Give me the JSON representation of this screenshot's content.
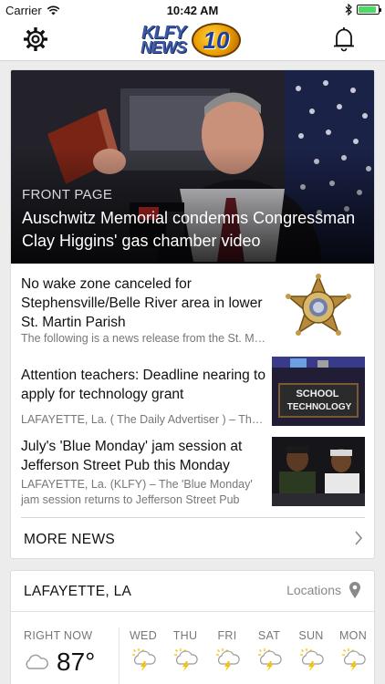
{
  "status_bar": {
    "carrier": "Carrier",
    "time": "10:42 AM",
    "battery_level": 0.9
  },
  "header": {
    "logo_text_top": "KLFY",
    "logo_text_bottom": "NEWS",
    "logo_number": "10"
  },
  "hero": {
    "kicker": "FRONT PAGE",
    "headline": "Auschwitz Memorial condemns Congressman Clay Higgins' gas chamber video"
  },
  "stories": [
    {
      "title": "No wake zone canceled for Stephensville/Belle River area in lower St. Martin Parish",
      "summary": "The following is a news release from the St. Martin Parish Sheriff's Office",
      "thumb_icon": "sheriff-star-badge"
    },
    {
      "title": "Attention teachers: Deadline nearing to apply for technology grant",
      "summary": "LAFAYETTE, La. ( The Daily Advertiser ) – The deadline to apply is near",
      "thumb_icon": "school-technology-chalkboard",
      "thumb_line1": "SCHOOL",
      "thumb_line2": "TECHNOLOGY"
    },
    {
      "title": "July's 'Blue Monday' jam session at Jefferson Street Pub this Monday",
      "summary": "LAFAYETTE, La. (KLFY) – The 'Blue Monday' jam session returns to Jefferson Street Pub next…",
      "thumb_icon": "musicians-photo"
    }
  ],
  "more_news": {
    "label": "MORE NEWS"
  },
  "weather": {
    "city": "LAFAYETTE, LA",
    "locations_label": "Locations",
    "right_now_label": "RIGHT NOW",
    "current_temp": "87°",
    "current_icon": "cloud-icon",
    "forecast": [
      {
        "day": "WED",
        "icon": "thunderstorm-icon"
      },
      {
        "day": "THU",
        "icon": "thunderstorm-icon"
      },
      {
        "day": "FRI",
        "icon": "thunderstorm-icon"
      },
      {
        "day": "SAT",
        "icon": "thunderstorm-icon"
      },
      {
        "day": "SUN",
        "icon": "thunderstorm-icon"
      },
      {
        "day": "MON",
        "icon": "thunderstorm-icon"
      }
    ]
  },
  "colors": {
    "accent_blue": "#3c59a8",
    "logo_gold": "#f0b000",
    "bolt_yellow": "#f5c400",
    "icon_gray": "#9a9a9a"
  }
}
